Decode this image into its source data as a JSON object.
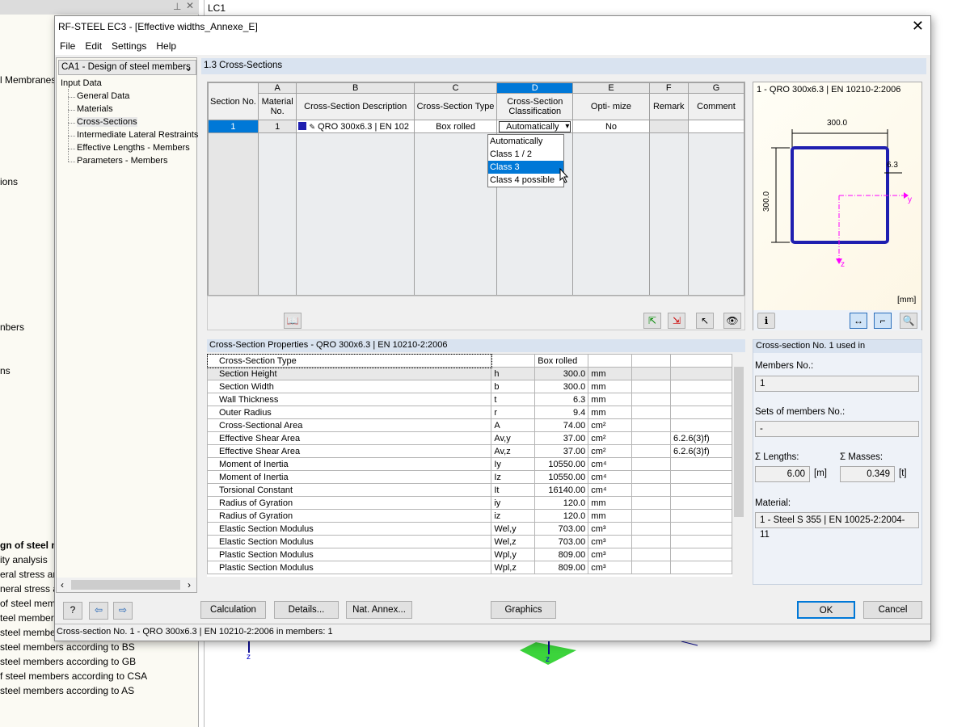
{
  "background": {
    "left_items": [
      "l Membranes",
      "ions",
      "nbers",
      "ns",
      "gn of steel m",
      "ity analysis",
      "eral stress ana",
      "neral stress ar",
      "of steel memb",
      "teel member",
      "steel membe",
      "steel members according to BS",
      "steel members according to GB",
      "f steel members according to CSA",
      "steel members according to AS"
    ],
    "tab_label": "LC1",
    "axis_z": "z"
  },
  "dialog": {
    "title": "RF-STEEL EC3 - [Effective widths_Annexe_E]",
    "close": "✕",
    "menu": [
      "File",
      "Edit",
      "Settings",
      "Help"
    ]
  },
  "nav": {
    "case": "CA1 - Design of steel members",
    "root": "Input Data",
    "items": [
      "General Data",
      "Materials",
      "Cross-Sections",
      "Intermediate Lateral Restraints",
      "Effective Lengths - Members",
      "Parameters - Members"
    ],
    "selected": 2
  },
  "section_title": "1.3 Cross-Sections",
  "grid": {
    "letters": [
      "",
      "A",
      "B",
      "C",
      "D",
      "E",
      "F",
      "G"
    ],
    "headers": [
      "Section No.",
      "Material No.",
      "Cross-Section Description",
      "Cross-Section Type",
      "Cross-Section Classification",
      "Opti- mize",
      "Remark",
      "Comment"
    ],
    "row": [
      "1",
      "1",
      "QRO 300x6.3 | EN 102",
      "Box rolled",
      "Automatically",
      "No",
      "",
      ""
    ],
    "dropdown": {
      "options": [
        "Automatically",
        "Class 1 / 2",
        "Class 3",
        "Class 4 possible"
      ],
      "highlighted": 2
    }
  },
  "preview": {
    "title": "1 - QRO 300x6.3 | EN 10210-2:2006",
    "width": "300.0",
    "height": "300.0",
    "thickness": "6.3",
    "axis_y": "y",
    "axis_z": "z",
    "unit": "[mm]"
  },
  "props": {
    "title": "Cross-Section Properties  -  QRO 300x6.3 | EN 10210-2:2006",
    "rows": [
      [
        "Cross-Section Type",
        "",
        "Box rolled",
        "",
        "",
        ""
      ],
      [
        "Section Height",
        "h",
        "300.0",
        "mm",
        "",
        ""
      ],
      [
        "Section Width",
        "b",
        "300.0",
        "mm",
        "",
        ""
      ],
      [
        "Wall Thickness",
        "t",
        "6.3",
        "mm",
        "",
        ""
      ],
      [
        "Outer Radius",
        "r",
        "9.4",
        "mm",
        "",
        ""
      ],
      [
        "Cross-Sectional Area",
        "A",
        "74.00",
        "cm²",
        "",
        ""
      ],
      [
        "Effective Shear Area",
        "Av,y",
        "37.00",
        "cm²",
        "",
        "6.2.6(3)f)"
      ],
      [
        "Effective Shear Area",
        "Av,z",
        "37.00",
        "cm²",
        "",
        "6.2.6(3)f)"
      ],
      [
        "Moment of Inertia",
        "Iy",
        "10550.00",
        "cm⁴",
        "",
        ""
      ],
      [
        "Moment of Inertia",
        "Iz",
        "10550.00",
        "cm⁴",
        "",
        ""
      ],
      [
        "Torsional Constant",
        "It",
        "16140.00",
        "cm⁴",
        "",
        ""
      ],
      [
        "Radius of Gyration",
        "iy",
        "120.0",
        "mm",
        "",
        ""
      ],
      [
        "Radius of Gyration",
        "iz",
        "120.0",
        "mm",
        "",
        ""
      ],
      [
        "Elastic Section Modulus",
        "Wel,y",
        "703.00",
        "cm³",
        "",
        ""
      ],
      [
        "Elastic Section Modulus",
        "Wel,z",
        "703.00",
        "cm³",
        "",
        ""
      ],
      [
        "Plastic Section Modulus",
        "Wpl,y",
        "809.00",
        "cm³",
        "",
        ""
      ],
      [
        "Plastic Section Modulus",
        "Wpl,z",
        "809.00",
        "cm³",
        "",
        ""
      ]
    ]
  },
  "usage": {
    "title": "Cross-section No. 1 used in",
    "members_label": "Members No.:",
    "members": "1",
    "sets_label": "Sets of members No.:",
    "sets": "-",
    "lengths_label": "Σ Lengths:",
    "lengths": "6.00",
    "lengths_unit": "[m]",
    "masses_label": "Σ Masses:",
    "masses": "0.349",
    "masses_unit": "[t]",
    "material_label": "Material:",
    "material": "1 - Steel S 355 | EN 10025-2:2004-11"
  },
  "buttons": {
    "calculation": "Calculation",
    "details": "Details...",
    "annex": "Nat. Annex...",
    "graphics": "Graphics",
    "ok": "OK",
    "cancel": "Cancel"
  },
  "status": "Cross-section No. 1 - QRO 300x6.3 | EN 10210-2:2006 in members: 1",
  "colors": {
    "selection": "#0078d7",
    "section_header": "#d9e3f0",
    "axis": "#ff00ff",
    "profile": "#1f1fb0"
  }
}
